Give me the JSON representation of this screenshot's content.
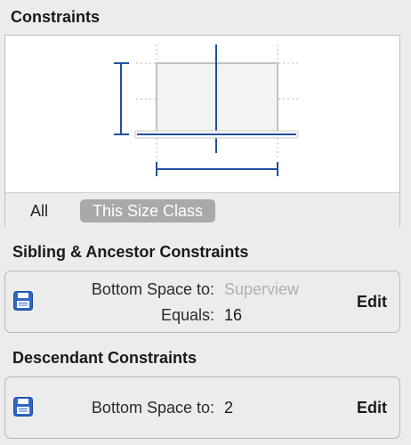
{
  "constraints_section": {
    "title": "Constraints",
    "size_class": {
      "all_label": "All",
      "selected_label": "This Size Class"
    }
  },
  "sibling_section": {
    "title": "Sibling & Ancestor Constraints",
    "constraint": {
      "first_item_label": "Bottom Space to:",
      "first_item_value": "Superview",
      "relation_label": "Equals:",
      "constant_value": "16",
      "edit_label": "Edit",
      "icon": "floppy-constraint-icon"
    }
  },
  "descendant_section": {
    "title": "Descendant Constraints",
    "constraint": {
      "first_item_label": "Bottom Space to:",
      "constant_value": "2",
      "edit_label": "Edit",
      "icon": "floppy-constraint-icon"
    }
  },
  "colors": {
    "constraint_line": "#1f4fa0",
    "selected_segment": "#a9a9a9",
    "background": "#ececec"
  }
}
